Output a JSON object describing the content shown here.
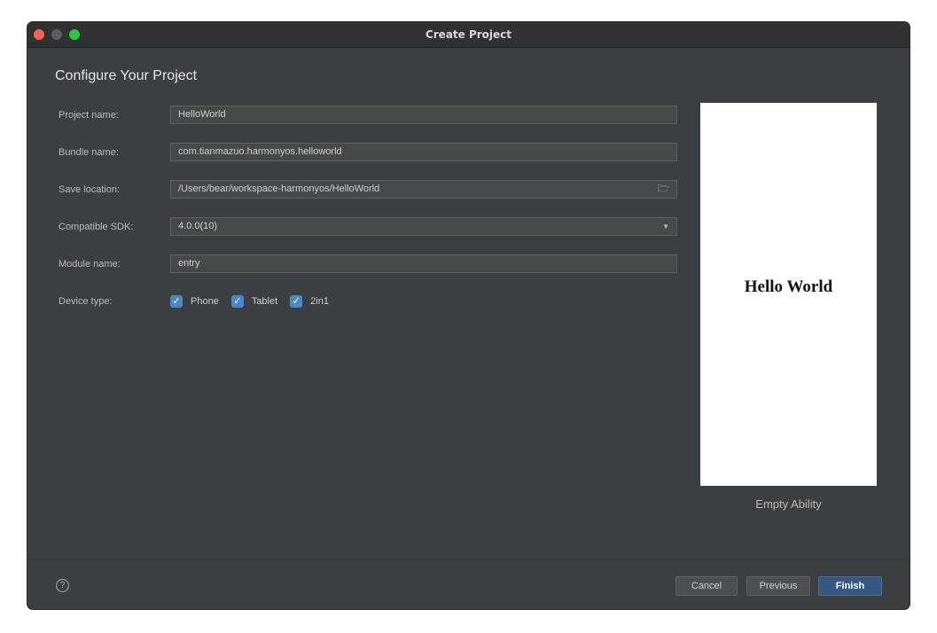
{
  "window": {
    "title": "Create Project"
  },
  "heading": "Configure Your Project",
  "form": {
    "project_name_label": "Project name:",
    "project_name_value": "HelloWorld",
    "bundle_name_label": "Bundle name:",
    "bundle_name_value": "com.tianmazuo.harmonyos.helloworld",
    "save_location_label": "Save location:",
    "save_location_value": "/Users/bear/workspace-harmonyos/HelloWorld",
    "compatible_sdk_label": "Compatible SDK:",
    "compatible_sdk_value": "4.0.0(10)",
    "module_name_label": "Module name:",
    "module_name_value": "entry",
    "device_type_label": "Device type:",
    "device_types": [
      {
        "label": "Phone",
        "checked": true
      },
      {
        "label": "Tablet",
        "checked": true
      },
      {
        "label": "2in1",
        "checked": true
      }
    ]
  },
  "preview": {
    "text": "Hello World",
    "template_name": "Empty Ability"
  },
  "footer": {
    "help_glyph": "?",
    "cancel_label": "Cancel",
    "previous_label": "Previous",
    "finish_label": "Finish"
  },
  "colors": {
    "background": "#3c3f41",
    "accent": "#4a88c7",
    "primary_button": "#365880"
  }
}
